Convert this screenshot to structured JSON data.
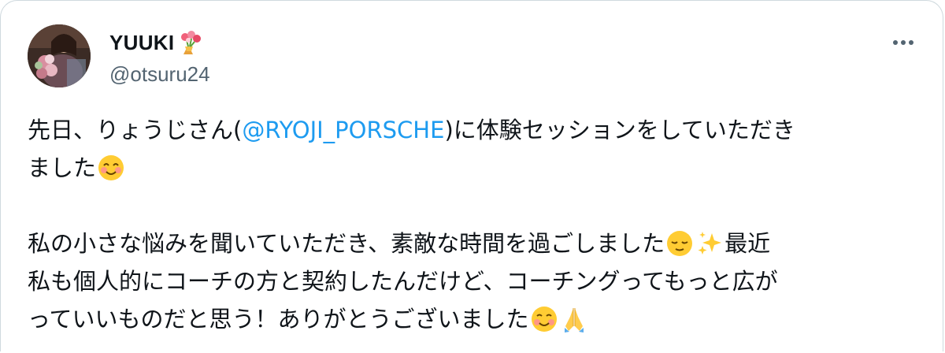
{
  "user": {
    "display_name": "YUUKI",
    "handle": "@otsuru24"
  },
  "icons": {
    "name_emoji": "bouquet-icon",
    "more": "more-dots-icon"
  },
  "tweet": {
    "line1_prefix": "先日、りょうじさん(",
    "mention": "@RYOJI_PORSCHE",
    "line1_suffix": ")に体験セッションをしていただき",
    "line2": "ました",
    "line3": "私の小さな悩みを聞いていただき、素敵な時間を過ごしました",
    "line3_end": "最近",
    "line4": "私も個人的にコーチの方と契約したんだけど、コーチングってもっと広が",
    "line5": "っていいものだと思う！ありがとうございました"
  },
  "colors": {
    "link": "#1d9bf0",
    "secondary_text": "#536471",
    "border": "#cfd9de"
  }
}
